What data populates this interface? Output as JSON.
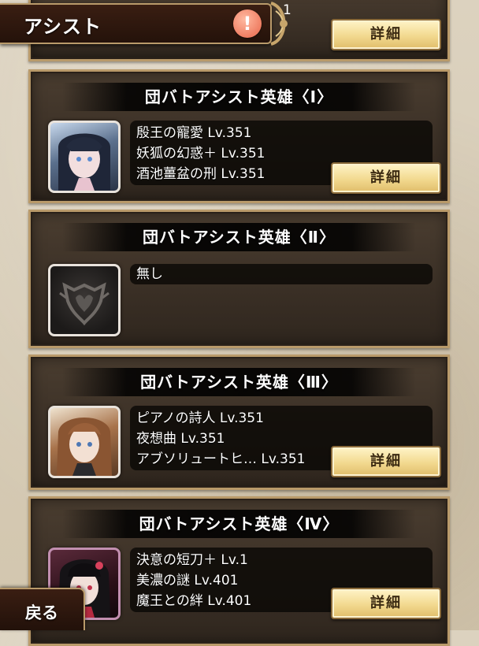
{
  "header": {
    "title": "アシスト",
    "notice_badge": "!",
    "partial_text": "1"
  },
  "detail_label": "詳細",
  "back_label": "戻る",
  "slots": [
    {
      "title": "団バトアシスト英雄〈Ⅰ〉",
      "skills": [
        "殷王の寵愛 Lv.351",
        "妖狐の幻惑＋ Lv.351",
        "酒池薑盆の刑 Lv.351"
      ]
    },
    {
      "title": "団バトアシスト英雄〈Ⅱ〉",
      "skills": [
        "無し"
      ]
    },
    {
      "title": "団バトアシスト英雄〈Ⅲ〉",
      "skills": [
        "ピアノの詩人 Lv.351",
        "夜想曲 Lv.351",
        "アブソリュートヒ… Lv.351"
      ]
    },
    {
      "title": "団バトアシスト英雄〈Ⅳ〉",
      "skills": [
        "決意の短刀＋ Lv.1",
        "美濃の謎 Lv.401",
        "魔王との絆 Lv.401"
      ]
    }
  ],
  "colors": {
    "accent": "#b99a6a",
    "button": "#f2d98f",
    "badge": "#f08b6e"
  }
}
